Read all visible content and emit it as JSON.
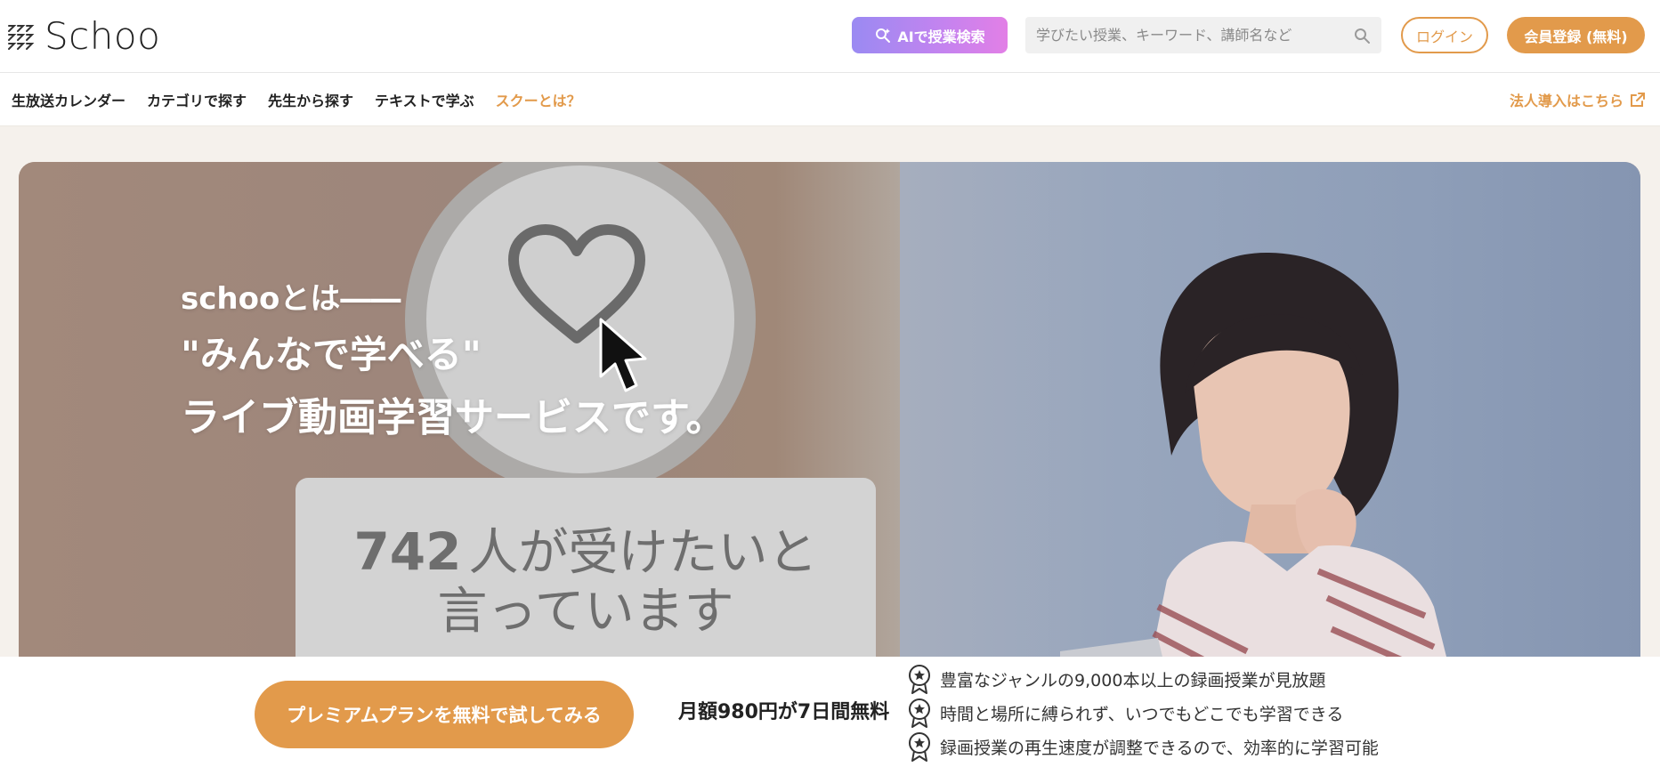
{
  "header": {
    "logo_text": "Schoo",
    "ai_search_label": "AIで授業検索",
    "search_placeholder": "学びたい授業、キーワード、講師名など",
    "login_label": "ログイン",
    "register_label": "会員登録 (無料)"
  },
  "nav": {
    "items": [
      {
        "label": "生放送カレンダー"
      },
      {
        "label": "カテゴリで探す"
      },
      {
        "label": "先生から探す"
      },
      {
        "label": "テキストで学ぶ"
      },
      {
        "label": "スクーとは？"
      }
    ],
    "corporate_link": "法人導入はこちら"
  },
  "hero": {
    "line1": "schooとは――",
    "line2": "\"みんなで学べる\"",
    "line3": "ライブ動画学習サービスです。",
    "card_number": "742",
    "card_text_1": "人が受けたいと",
    "card_text_2": "言っています"
  },
  "cta": {
    "trial_button": "プレミアムプランを無料で試してみる",
    "price_text": "月額980円が7日間無料",
    "features": [
      {
        "text": "豊富なジャンルの9,000本以上の録画授業が見放題"
      },
      {
        "text": "時間と場所に縛られず、いつでもどこでも学習できる"
      },
      {
        "text": "録画授業の再生速度が調整できるので、効率的に学習可能"
      }
    ]
  },
  "colors": {
    "accent": "#e29a4b",
    "ai_gradient_start": "#9a8af2",
    "ai_gradient_end": "#e27fe6"
  }
}
